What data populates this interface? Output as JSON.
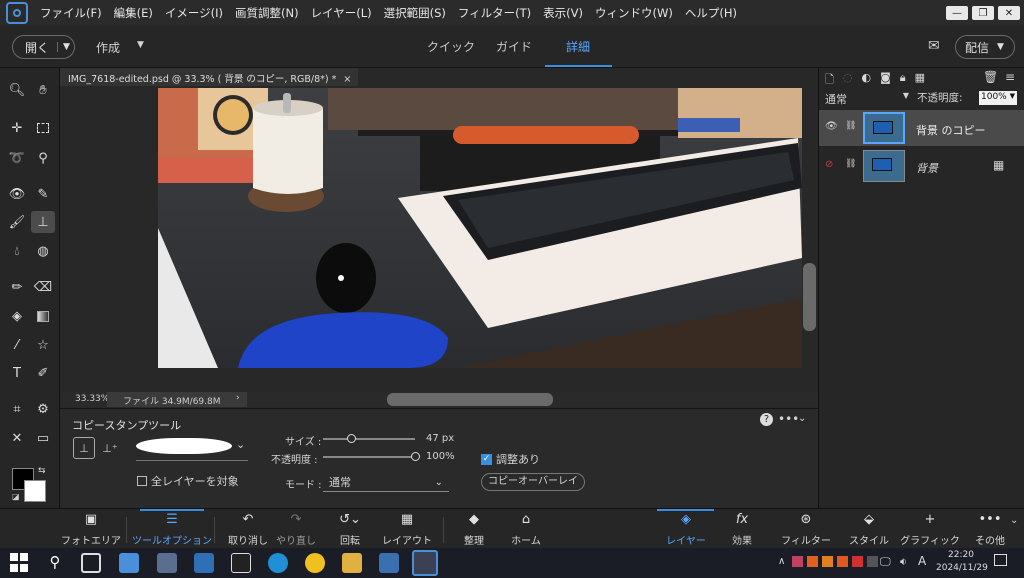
{
  "menubar": {
    "items": [
      "ファイル(F)",
      "編集(E)",
      "イメージ(I)",
      "画質調整(N)",
      "レイヤー(L)",
      "選択範囲(S)",
      "フィルター(T)",
      "表示(V)",
      "ウィンドウ(W)",
      "ヘルプ(H)"
    ],
    "window_buttons": [
      "—",
      "❐",
      "✕"
    ]
  },
  "modebar": {
    "open_label": "開く",
    "create_label": "作成",
    "tabs": [
      "クイック",
      "ガイド",
      "詳細"
    ],
    "active_tab": "詳細",
    "share_label": "配信"
  },
  "document": {
    "tab_title": "IMG_7618-edited.psd @ 33.3% ( 背景 のコピー, RGB/8*) *",
    "close": "×",
    "zoom": "33.33%",
    "file_info": "ファイル 34.9M/69.8M"
  },
  "layers_panel": {
    "blend_mode": "通常",
    "opacity_label": "不透明度:",
    "opacity_value": "100%",
    "layers": [
      {
        "name": "背景 のコピー",
        "selected": true
      },
      {
        "name": "背景",
        "selected": false
      }
    ]
  },
  "tool_options": {
    "tool_name": "コピースタンプツール",
    "size_label": "サイズ :",
    "size_value": "47 px",
    "size_level": 0.3,
    "opacity_label": "不透明度 :",
    "opacity_value": "100%",
    "opacity_level": 1.0,
    "mode_label": "モード :",
    "mode_value": "通常",
    "aligned_label": "調整あり",
    "aligned_checked": true,
    "all_layers_label": "全レイヤーを対象",
    "all_layers_checked": false,
    "overlay_button": "コピーオーバーレイ"
  },
  "bottombar": {
    "left": [
      {
        "label": "フォトエリア",
        "icon": "photo-bin-icon"
      },
      {
        "label": "ツールオプション",
        "icon": "tool-options-icon",
        "active": true
      },
      {
        "label": "取り消し",
        "icon": "undo-icon"
      },
      {
        "label": "やり直し",
        "icon": "redo-icon"
      },
      {
        "label": "回転",
        "icon": "rotate-icon"
      },
      {
        "label": "レイアウト",
        "icon": "layout-icon"
      },
      {
        "label": "整理",
        "icon": "organizer-icon"
      },
      {
        "label": "ホーム",
        "icon": "home-icon"
      }
    ],
    "right": [
      {
        "label": "レイヤー",
        "icon": "layers-icon",
        "active": true
      },
      {
        "label": "効果",
        "icon": "fx-icon"
      },
      {
        "label": "フィルター",
        "icon": "filter-icon"
      },
      {
        "label": "スタイル",
        "icon": "style-icon"
      },
      {
        "label": "グラフィック",
        "icon": "graphics-icon"
      },
      {
        "label": "その他",
        "icon": "more-icon"
      }
    ]
  },
  "taskbar": {
    "time": "22:20",
    "date": "2024/11/29",
    "ime": "A"
  },
  "colors": {
    "accent": "#3a8fe0",
    "selected_tab": "#5aa7ff"
  }
}
